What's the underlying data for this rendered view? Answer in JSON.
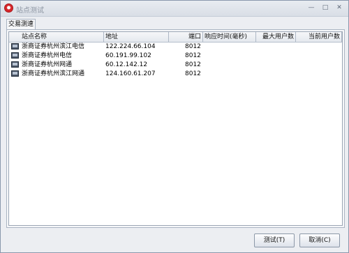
{
  "window": {
    "title": "站点测试",
    "min_glyph": "—",
    "max_glyph": "□",
    "close_glyph": "✕"
  },
  "tab": {
    "label": "交易测速"
  },
  "table": {
    "headers": [
      "站点名称",
      "地址",
      "端口",
      "响应时间(毫秒)",
      "最大用户数",
      "当前用户数"
    ],
    "rows": [
      {
        "name": "浙商证券杭州滨江电信",
        "address": "122.224.66.104",
        "port": "8012",
        "response": "",
        "max_users": "",
        "current_users": "",
        "icon": "server-icon"
      },
      {
        "name": "浙商证券杭州电信",
        "address": "60.191.99.102",
        "port": "8012",
        "response": "",
        "max_users": "",
        "current_users": "",
        "icon": "server-icon"
      },
      {
        "name": "浙商证券杭州网通",
        "address": "60.12.142.12",
        "port": "8012",
        "response": "",
        "max_users": "",
        "current_users": "",
        "icon": "server-icon"
      },
      {
        "name": "浙商证券杭州滨江网通",
        "address": "124.160.61.207",
        "port": "8012",
        "response": "",
        "max_users": "",
        "current_users": "",
        "icon": "server-icon"
      }
    ]
  },
  "buttons": {
    "test": "测试(T)",
    "cancel": "取消(C)"
  },
  "colors": {
    "title_text": "#8d96a3",
    "app_icon": "#d7262a",
    "window_bg": "#eceef2"
  }
}
